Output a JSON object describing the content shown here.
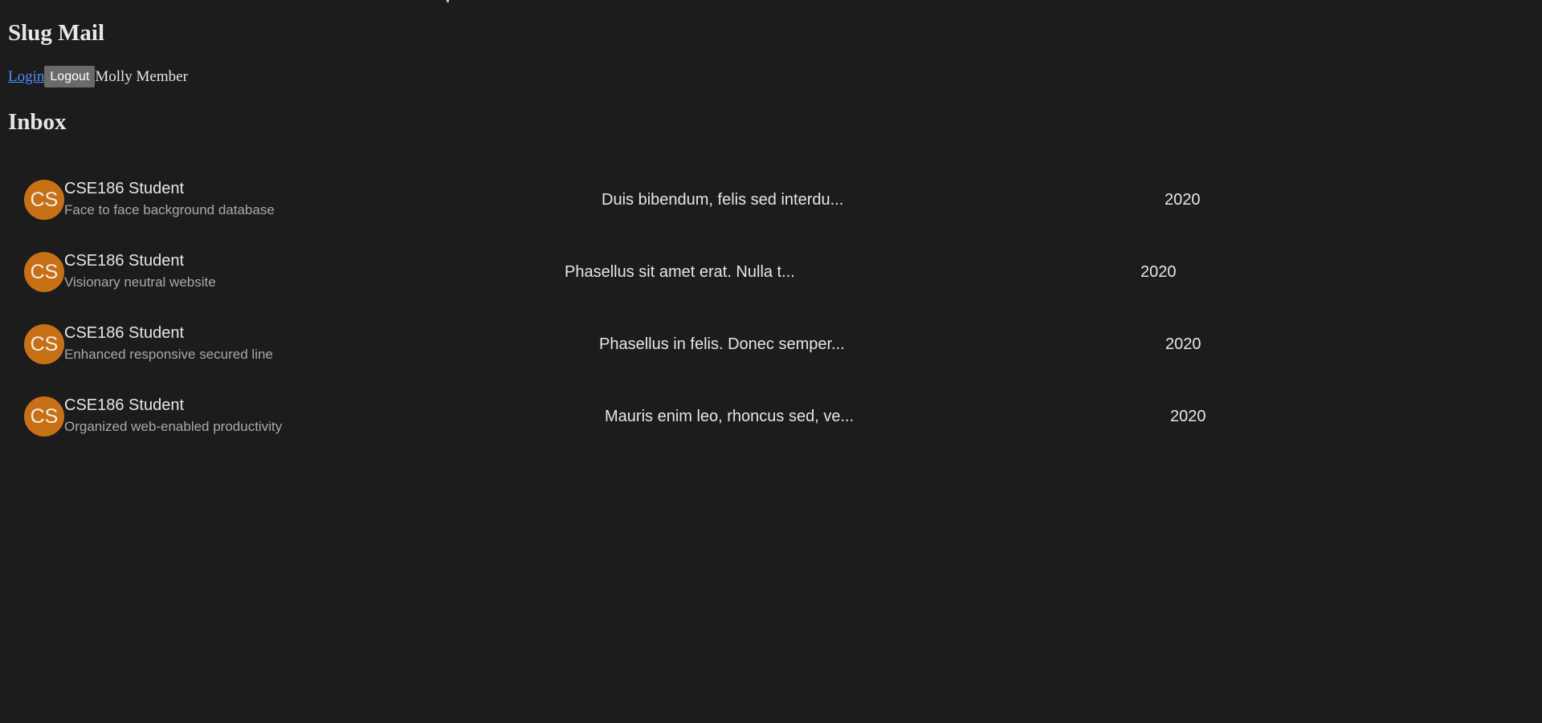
{
  "app": {
    "title": "Slug Mail"
  },
  "auth": {
    "login_label": "Login",
    "logout_label": "Logout",
    "user_name": "Molly Member"
  },
  "inbox": {
    "title": "Inbox",
    "messages": [
      {
        "avatar_initials": "CS",
        "sender": "CSE186 Student",
        "subject": "Face to face background database",
        "preview": "Duis bibendum, felis sed interdu...",
        "date": "2020"
      },
      {
        "avatar_initials": "CS",
        "sender": "CSE186 Student",
        "subject": "Visionary neutral website",
        "preview": "Phasellus sit amet erat. Nulla t...",
        "date": "2020"
      },
      {
        "avatar_initials": "CS",
        "sender": "CSE186 Student",
        "subject": "Enhanced responsive secured line",
        "preview": "Phasellus in felis. Donec semper...",
        "date": "2020"
      },
      {
        "avatar_initials": "CS",
        "sender": "CSE186 Student",
        "subject": "Organized web-enabled productivity",
        "preview": "Mauris enim leo, rhoncus sed, ve...",
        "date": "2020"
      }
    ]
  },
  "colors": {
    "background": "#1b1c1b",
    "text": "#e8e6e3",
    "muted_text": "#aaa9a6",
    "link": "#4f8dff",
    "logout_button": "#6a6a6a",
    "avatar": "#c77016"
  }
}
